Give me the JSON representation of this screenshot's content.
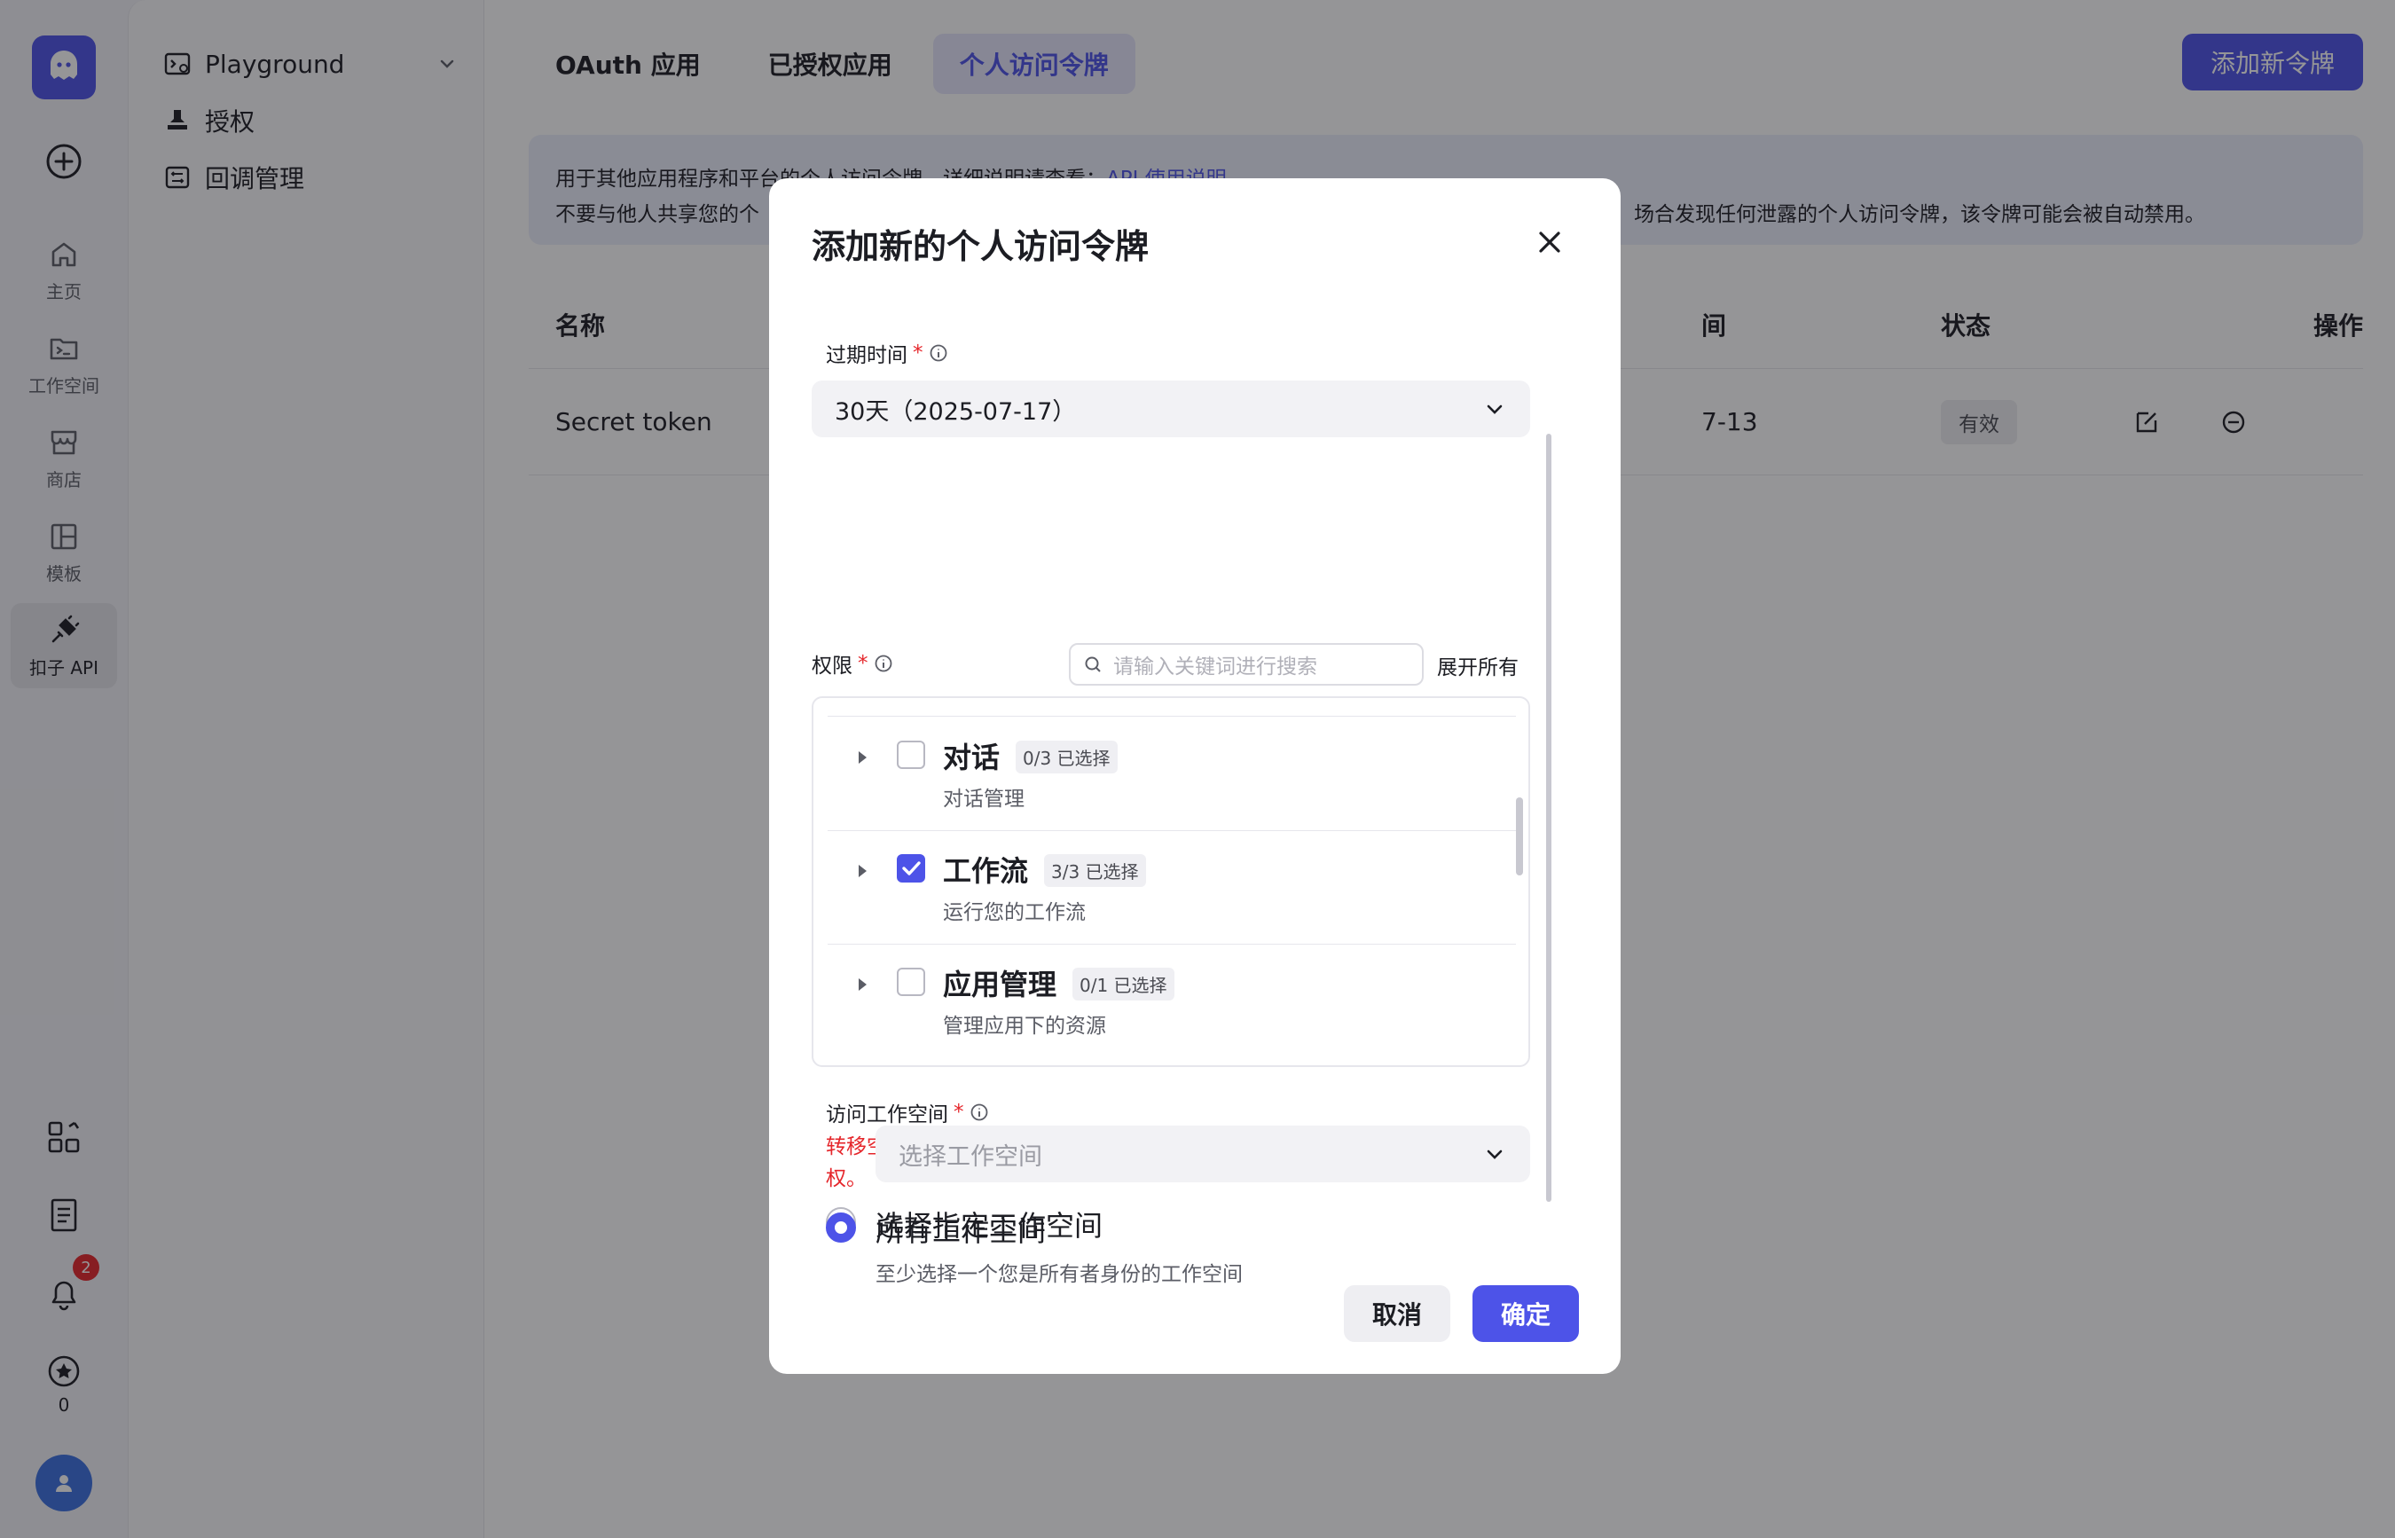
{
  "rail": {
    "items": [
      {
        "label": "主页",
        "icon": "home-icon"
      },
      {
        "label": "工作空间",
        "icon": "workspace-icon"
      },
      {
        "label": "商店",
        "icon": "store-icon"
      },
      {
        "label": "模板",
        "icon": "template-icon"
      },
      {
        "label": "扣子 API",
        "icon": "api-icon"
      }
    ],
    "notification_count": "2",
    "star_count": "0"
  },
  "sidebar": {
    "items": [
      {
        "label": "Playground"
      },
      {
        "label": "授权"
      },
      {
        "label": "回调管理"
      }
    ]
  },
  "main": {
    "tabs": [
      {
        "label": "OAuth 应用"
      },
      {
        "label": "已授权应用"
      },
      {
        "label": "个人访问令牌"
      }
    ],
    "add_button": "添加新令牌",
    "notice_line1": "用于其他应用程序和平台的个人访问令牌。详细说明请查看：",
    "notice_link": "API 使用说明",
    "notice_line2_left": "不要与他人共享您的个",
    "notice_line2_right": "场合发现任何泄露的个人访问令牌，该令牌可能会被自动禁用。",
    "table": {
      "headers": [
        "名称",
        "间",
        "状态",
        "操作"
      ],
      "rows": [
        {
          "name": "Secret token",
          "date_tail": "7-13",
          "status": "有效"
        }
      ]
    }
  },
  "modal": {
    "title": "添加新的个人访问令牌",
    "expiry": {
      "label": "过期时间",
      "value": "30天（2025-07-17）"
    },
    "permissions": {
      "label": "权限",
      "search_placeholder": "请输入关键词进行搜索",
      "expand_all": "展开所有",
      "items": [
        {
          "name": "对话",
          "count": "0/3 已选择",
          "desc": "对话管理",
          "checked": false
        },
        {
          "name": "工作流",
          "count": "3/3 已选择",
          "desc": "运行您的工作流",
          "checked": true
        },
        {
          "name": "应用管理",
          "count": "0/1 已选择",
          "desc": "管理应用下的资源",
          "checked": false
        }
      ]
    },
    "workspace": {
      "label": "访问工作空间",
      "warning": "转移空间所有权会导致该空间已申请的个人访问令牌失效，请慎重转移所有权。",
      "option_specific": "选择指定工作空间",
      "option_specific_hint": "至少选择一个您是所有者身份的工作空间",
      "select_placeholder": "选择工作空间",
      "option_all": "所有工作空间"
    },
    "cancel": "取消",
    "confirm": "确定"
  },
  "colors": {
    "accent": "#4d53e8",
    "danger": "#e5262b"
  }
}
